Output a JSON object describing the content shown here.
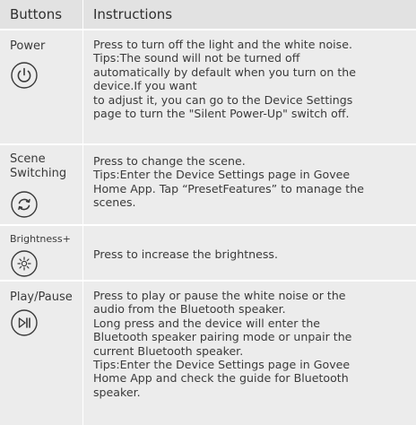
{
  "header": {
    "buttons": "Buttons",
    "instructions": "Instructions"
  },
  "rows": [
    {
      "label": "Power",
      "icon": "power-icon",
      "instruction": "Press to turn off the light and the white noise.\nTips:The sound will not be turned off\nautomatically by default when you turn on the\ndevice.If you want\nto adjust it, you can go to the Device Settings\npage to turn the \"Silent Power-Up\" switch off."
    },
    {
      "label": "Scene\nSwitching",
      "icon": "scene-switch-icon",
      "instruction": "Press to change the scene.\nTips:Enter the Device Settings page in Govee\nHome App. Tap “PresetFeatures” to manage the\nscenes."
    },
    {
      "label": "Brightness+",
      "icon": "brightness-icon",
      "instruction": "Press to increase the brightness."
    },
    {
      "label": "Play/Pause",
      "icon": "play-pause-icon",
      "instruction": "Press to play or pause the white noise or the\naudio from the Bluetooth speaker.\nLong press and the device will enter the\nBluetooth speaker pairing mode or unpair the\ncurrent Bluetooth speaker.\nTips:Enter the Device Settings page in Govee\nHome App and check the guide for Bluetooth\nspeaker."
    }
  ]
}
